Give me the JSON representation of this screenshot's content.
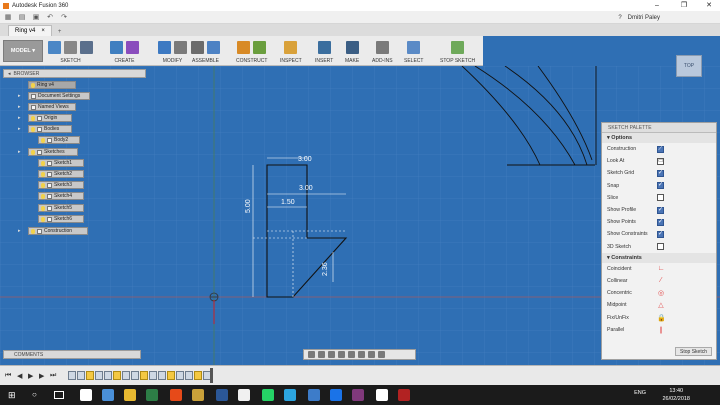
{
  "window": {
    "title": "Autodesk Fusion 360",
    "min": "–",
    "max": "❐",
    "close": "✕"
  },
  "user": {
    "help": "?",
    "name": "Dmitri Paley"
  },
  "document_tab": {
    "title": "Ring v4",
    "close": "×",
    "add": "+"
  },
  "workspace": {
    "label": "MODEL"
  },
  "toolbar": {
    "groups": [
      {
        "label": "SKETCH",
        "colors": [
          "#4b87c6",
          "#888888",
          "#5a6f8c"
        ]
      },
      {
        "label": "CREATE",
        "colors": [
          "#3f7fc0",
          "#8a4dbd"
        ]
      },
      {
        "label": "MODIFY",
        "colors": [
          "#3c79c2",
          "#7a7a7a"
        ]
      },
      {
        "label": "ASSEMBLE",
        "colors": [
          "#6b6b6b",
          "#4d82c4"
        ]
      },
      {
        "label": "CONSTRUCT",
        "colors": [
          "#d88a26",
          "#6a9e3e"
        ]
      },
      {
        "label": "INSPECT",
        "colors": [
          "#d9a13a"
        ]
      },
      {
        "label": "INSERT",
        "colors": [
          "#3b6e9e"
        ]
      },
      {
        "label": "MAKE",
        "colors": [
          "#3b5e84"
        ]
      },
      {
        "label": "ADD-INS",
        "colors": [
          "#7a7a7a"
        ]
      },
      {
        "label": "SELECT",
        "colors": [
          "#5a8ac6"
        ]
      },
      {
        "label": "STOP SKETCH",
        "colors": [
          "#6ea95a"
        ]
      }
    ]
  },
  "viewcube": {
    "label": "TOP"
  },
  "browser": {
    "title": "BROWSER",
    "root": "Ring v4",
    "items": [
      {
        "label": "Document Settings"
      },
      {
        "label": "Named Views"
      },
      {
        "label": "Origin"
      },
      {
        "label": "Bodies"
      },
      {
        "label": "Body2"
      },
      {
        "label": "Sketches"
      },
      {
        "label": "Sketch1"
      },
      {
        "label": "Sketch2"
      },
      {
        "label": "Sketch3"
      },
      {
        "label": "Sketch4"
      },
      {
        "label": "Sketch5"
      },
      {
        "label": "Sketch6"
      },
      {
        "label": "Construction"
      }
    ]
  },
  "dimensions": {
    "top_width": "3.00",
    "mid_width": "3.00",
    "inner_width": "1.50",
    "height": "5.00",
    "slant": "2.36"
  },
  "sketch_palette": {
    "title": "SKETCH PALETTE",
    "options_title": "Options",
    "options": [
      {
        "label": "Construction",
        "state": "active"
      },
      {
        "label": "Look At",
        "state": "icon"
      },
      {
        "label": "Sketch Grid",
        "state": "on"
      },
      {
        "label": "Snap",
        "state": "on"
      },
      {
        "label": "Slice",
        "state": "off"
      },
      {
        "label": "Show Profile",
        "state": "on"
      },
      {
        "label": "Show Points",
        "state": "on"
      },
      {
        "label": "Show Constraints",
        "state": "on"
      },
      {
        "label": "3D Sketch",
        "state": "off"
      }
    ],
    "constraints_title": "Constraints",
    "constraints": [
      {
        "label": "Coincident",
        "glyph": "∟"
      },
      {
        "label": "Collinear",
        "glyph": "⁄"
      },
      {
        "label": "Concentric",
        "glyph": "◎"
      },
      {
        "label": "Midpoint",
        "glyph": "△"
      },
      {
        "label": "Fix/UnFix",
        "glyph": "🔒"
      },
      {
        "label": "Parallel",
        "glyph": "∥"
      }
    ],
    "stop_button": "Stop Sketch"
  },
  "comments": {
    "label": "COMMENTS"
  },
  "taskbar": {
    "lang": "ENG",
    "time": "13:40",
    "date": "26/02/2018",
    "apps": [
      "#ffffff",
      "#4a90d9",
      "#e8b931",
      "#2d7d46",
      "#e64a19",
      "#c9a13a",
      "#2b5797",
      "#f0f0f0",
      "#25d366",
      "#2ca5e0",
      "#3d7cc9",
      "#1a73e8",
      "#80397b",
      "#ffffff",
      "#b22222"
    ]
  }
}
